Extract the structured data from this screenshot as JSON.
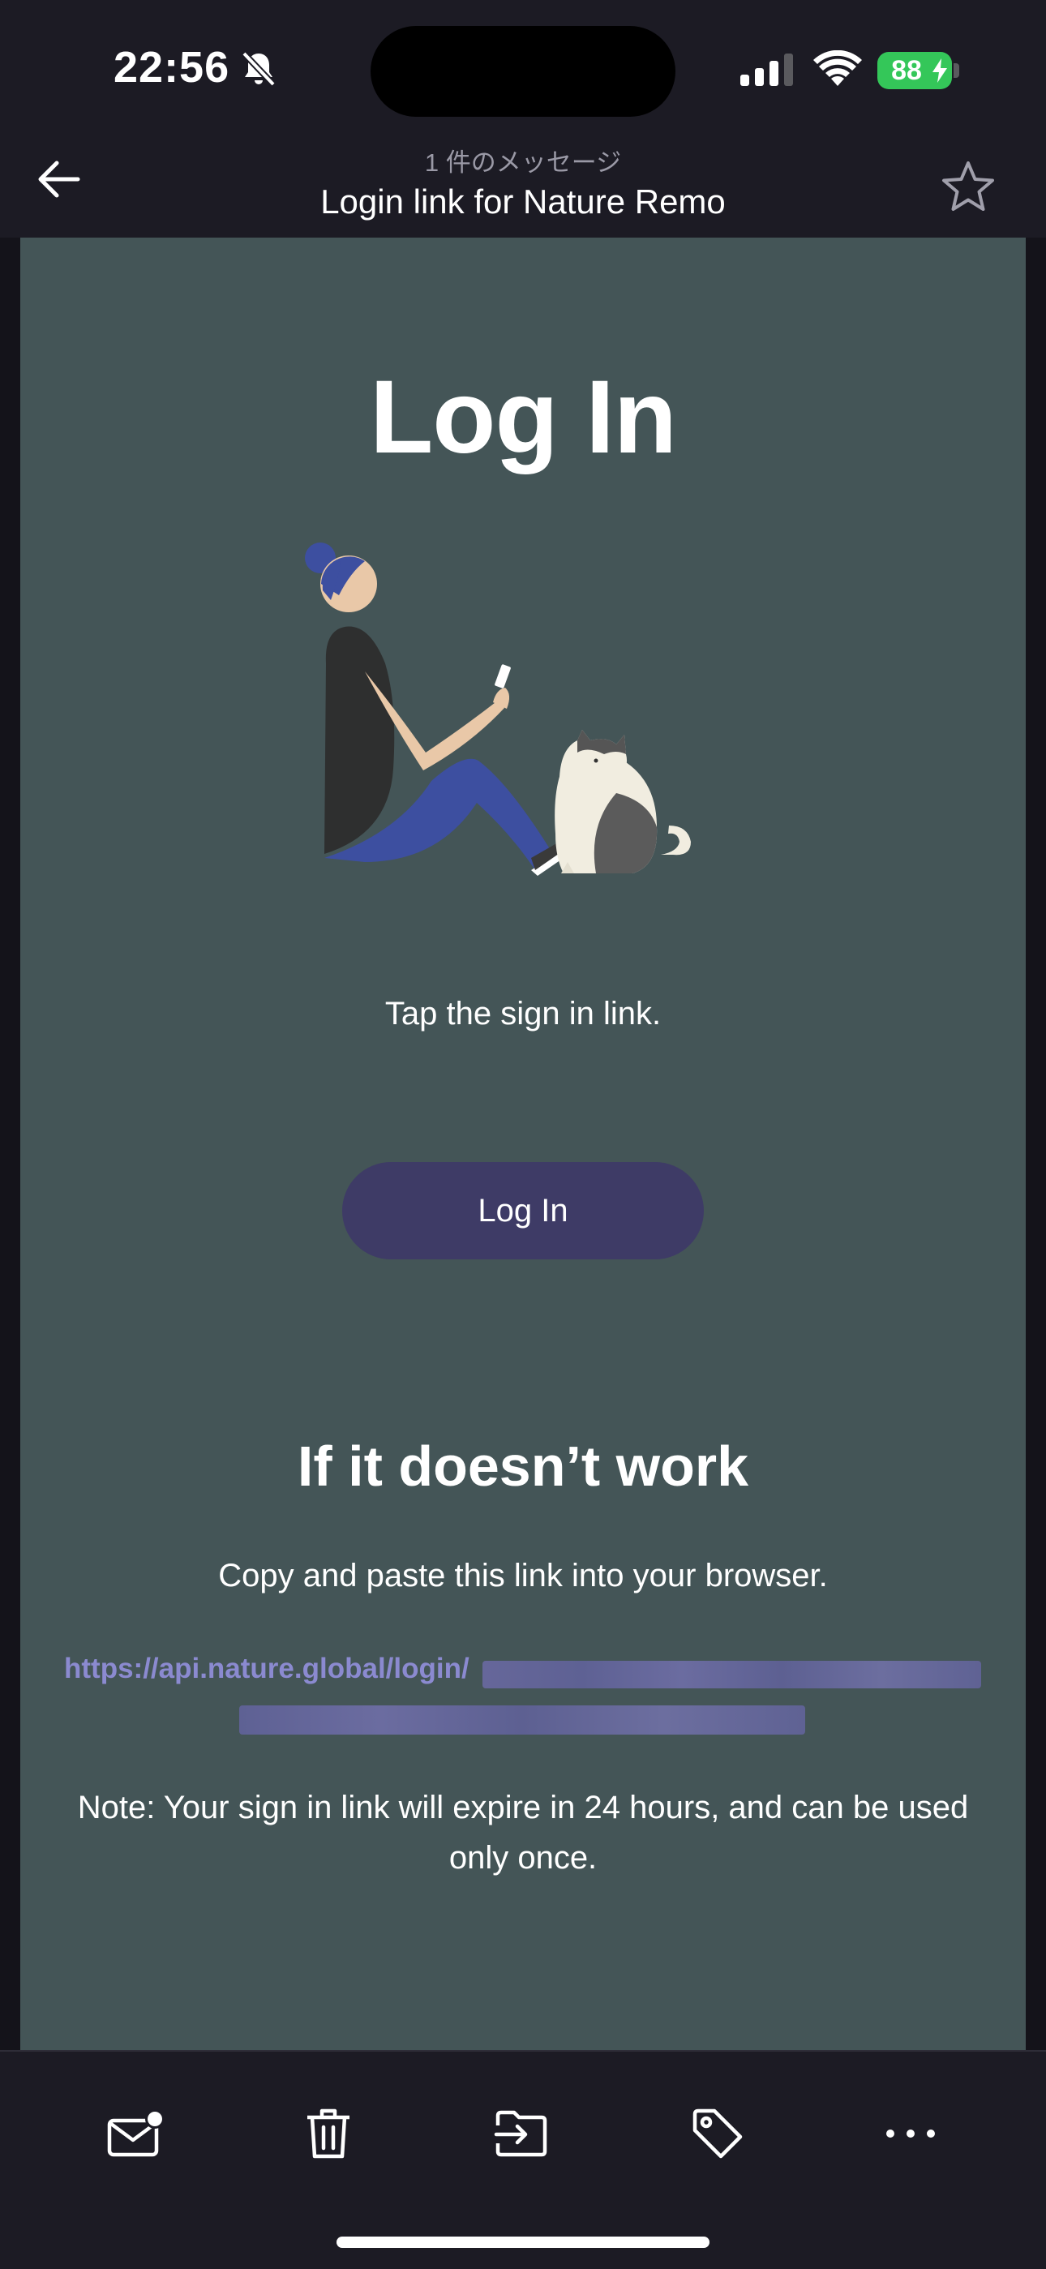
{
  "status_bar": {
    "time": "22:56",
    "battery": "88"
  },
  "header": {
    "subtitle": "1 件のメッセージ",
    "title": "Login link for Nature Remo"
  },
  "email": {
    "heading": "Log In",
    "instruction": "Tap the sign in link.",
    "button_label": "Log In",
    "fallback_heading": "If it doesn’t work",
    "fallback_text": "Copy and paste this link into your browser.",
    "link_text": "https://api.nature.global/login/",
    "note": "Note: Your sign in link will expire in 24 hours, and can be used only once."
  },
  "toolbar": {
    "items": [
      "mail-unread-icon",
      "trash-icon",
      "move-to-folder-icon",
      "tag-icon",
      "more-icon"
    ]
  },
  "colors": {
    "email_bg": "#445557",
    "button_bg": "#3e3b66",
    "link": "#8b8ad0",
    "battery": "#34c759"
  }
}
